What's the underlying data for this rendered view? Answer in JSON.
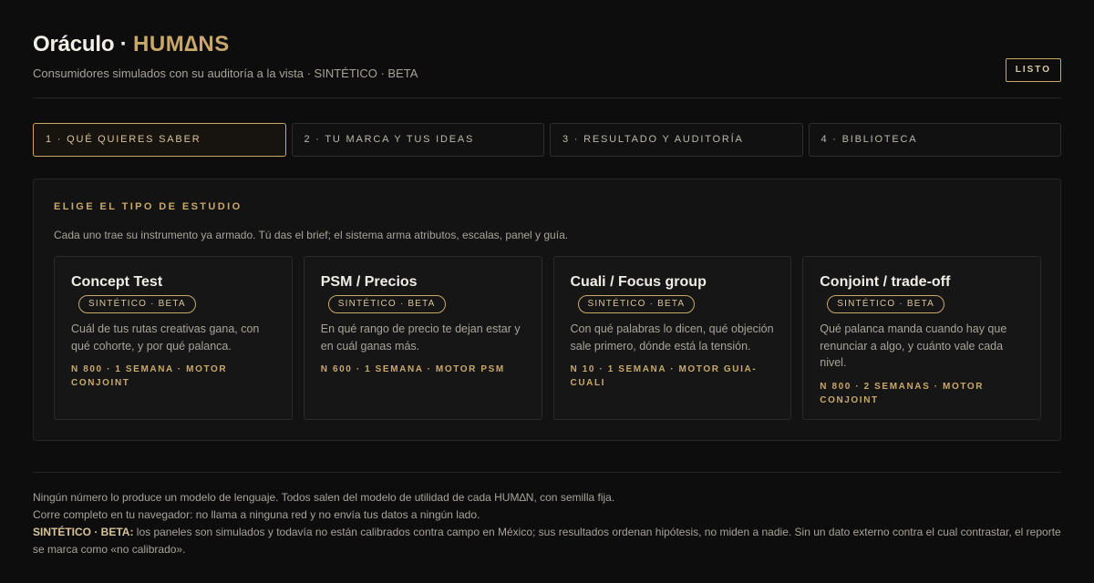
{
  "header": {
    "title_main": "Oráculo",
    "title_sep": " · ",
    "title_brand": "HUM∆NS",
    "subtitle": "Consumidores simulados con su auditoría a la vista · SINTÉTICO · BETA",
    "status_button": "LISTO"
  },
  "tabs": [
    {
      "label": "1 · QUÉ QUIERES SABER",
      "active": true
    },
    {
      "label": "2 · TU MARCA Y TUS IDEAS",
      "active": false
    },
    {
      "label": "3 · RESULTADO Y AUDITORÍA",
      "active": false
    },
    {
      "label": "4 · BIBLIOTECA",
      "active": false
    }
  ],
  "panel": {
    "heading": "ELIGE EL TIPO DE ESTUDIO",
    "description": "Cada uno trae su instrumento ya armado. Tú das el brief; el sistema arma atributos, escalas, panel y guía.",
    "cards": [
      {
        "title": "Concept Test",
        "badge": "SINTÉTICO · BETA",
        "description": "Cuál de tus rutas creativas gana, con qué cohorte, y por qué palanca.",
        "meta": "N 800 · 1 SEMANA · MOTOR CONJOINT"
      },
      {
        "title": "PSM / Precios",
        "badge": "SINTÉTICO · BETA",
        "description": "En qué rango de precio te dejan estar y en cuál ganas más.",
        "meta": "N 600 · 1 SEMANA · MOTOR PSM"
      },
      {
        "title": "Cuali / Focus group",
        "badge": "SINTÉTICO · BETA",
        "description": "Con qué palabras lo dicen, qué objeción sale primero, dónde está la tensión.",
        "meta": "N 10 · 1 SEMANA · MOTOR GUIA-CUALI"
      },
      {
        "title": "Conjoint / trade-off",
        "badge": "SINTÉTICO · BETA",
        "description": "Qué palanca manda cuando hay que renunciar a algo, y cuánto vale cada nivel.",
        "meta": "N 800 · 2 SEMANAS · MOTOR CONJOINT"
      }
    ]
  },
  "footer": {
    "line1": "Ningún número lo produce un modelo de lenguaje. Todos salen del modelo de utilidad de cada HUM∆N, con semilla fija.",
    "line2": "Corre completo en tu navegador: no llama a ninguna red y no envía tus datos a ningún lado.",
    "line3_label": "SINTÉTICO · BETA:",
    "line3_text": " los paneles son simulados y todavía no están calibrados contra campo en México; sus resultados ordenan hipótesis, no miden a nadie. Sin un dato externo contra el cual contrastar, el reporte se marca como «no calibrado»."
  },
  "colors": {
    "background": "#0d0d0d",
    "accent": "#c9a86a",
    "text_muted": "#a8a39a"
  }
}
